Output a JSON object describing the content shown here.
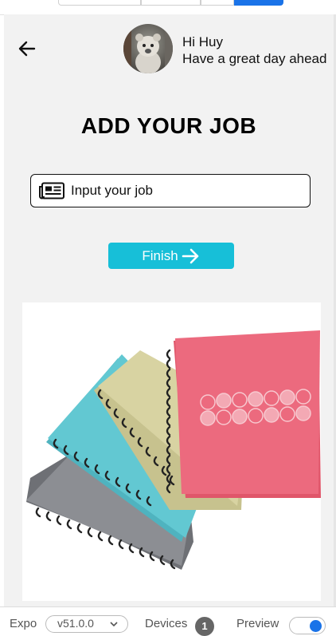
{
  "header": {
    "greeting": "Hi Huy",
    "subtitle": "Have a great day ahead"
  },
  "page": {
    "title": "ADD YOUR JOB"
  },
  "job_input": {
    "placeholder": "Input your job",
    "value": ""
  },
  "finish_button": {
    "label": "Finish"
  },
  "bottom_bar": {
    "expo_label": "Expo",
    "version": "v51.0.0",
    "devices_label": "Devices",
    "devices_count": "1",
    "preview_label": "Preview"
  },
  "colors": {
    "accent": "#17bfd8",
    "app_background": "#f2f2f2",
    "toolbar_active": "#1a73e8"
  },
  "icons": [
    "arrow-left-icon",
    "newspaper-icon",
    "arrow-right-icon",
    "chevron-down-icon"
  ]
}
